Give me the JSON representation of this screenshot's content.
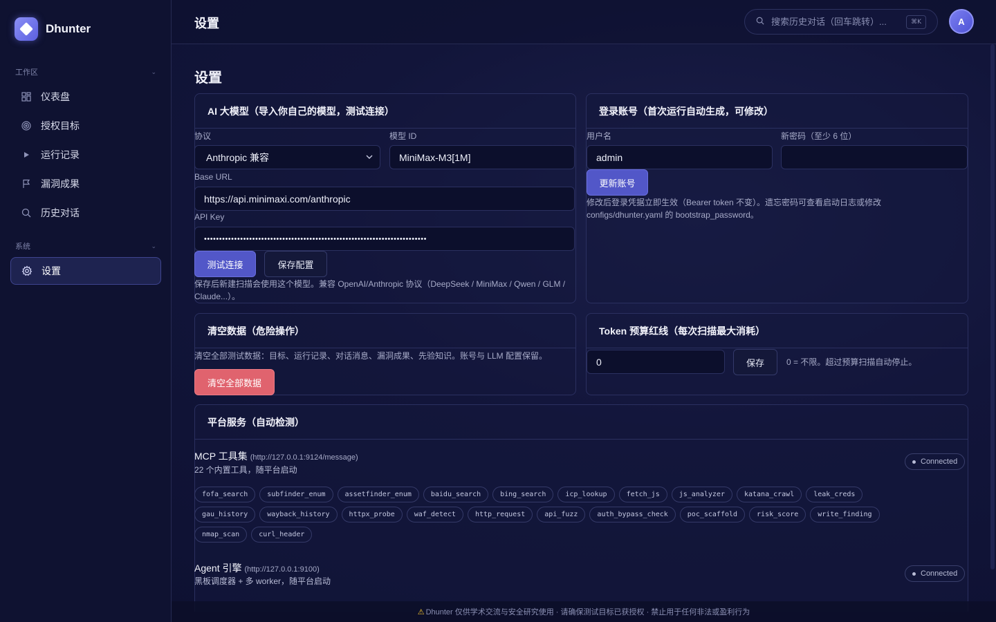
{
  "app": {
    "name": "Dhunter"
  },
  "sidebar": {
    "sections": [
      {
        "label": "工作区",
        "items": [
          {
            "label": "仪表盘",
            "icon": "grid-icon"
          },
          {
            "label": "授权目标",
            "icon": "target-icon"
          },
          {
            "label": "运行记录",
            "icon": "play-icon"
          },
          {
            "label": "漏洞成果",
            "icon": "flag-icon"
          },
          {
            "label": "历史对话",
            "icon": "search-icon"
          }
        ]
      },
      {
        "label": "系统",
        "items": [
          {
            "label": "设置",
            "icon": "gear-icon",
            "active": true
          }
        ]
      }
    ]
  },
  "topbar": {
    "title": "设置",
    "search": {
      "placeholder": "搜索历史对话（回车跳转）...",
      "shortcut": "⌘K"
    },
    "avatar": "A"
  },
  "page": {
    "title": "设置"
  },
  "llm_card": {
    "title": "AI 大模型（导入你自己的模型，测试连接）",
    "protocol_label": "协议",
    "protocol_value": "Anthropic 兼容",
    "model_label": "模型 ID",
    "model_value": "MiniMax-M3[1M]",
    "base_url_label": "Base URL",
    "base_url_value": "https://api.minimaxi.com/anthropic",
    "api_key_label": "API Key",
    "api_key_value": "••••••••••••••••••••••••••••••••••••••••••••••••••••••••••••••••••••••••••",
    "test_button": "测试连接",
    "save_button": "保存配置",
    "note": "保存后新建扫描会使用这个模型。兼容 OpenAI/Anthropic 协议（DeepSeek / MiniMax / Qwen / GLM / Claude...）。"
  },
  "account_card": {
    "title": "登录账号（首次运行自动生成，可修改）",
    "username_label": "用户名",
    "username_value": "admin",
    "password_label": "新密码（至少 6 位）",
    "password_value": "",
    "update_button": "更新账号",
    "note": "修改后登录凭据立即生效（Bearer token 不变）。遗忘密码可查看启动日志或修改 configs/dhunter.yaml 的 bootstrap_password。"
  },
  "clear_card": {
    "title": "清空数据（危险操作）",
    "note": "清空全部测试数据：目标、运行记录、对话消息、漏洞成果、先验知识。账号与 LLM 配置保留。",
    "button": "清空全部数据"
  },
  "token_card": {
    "title": "Token 预算红线（每次扫描最大消耗）",
    "value": "0",
    "save_button": "保存",
    "note": "0 = 不限。超过预算扫描自动停止。"
  },
  "services_card": {
    "title": "平台服务（自动检测）",
    "mcp": {
      "name": "MCP 工具集",
      "url": "(http://127.0.0.1:9124/message)",
      "desc": "22 个内置工具，随平台启动",
      "status": "Connected",
      "tools": [
        "fofa_search",
        "subfinder_enum",
        "assetfinder_enum",
        "baidu_search",
        "bing_search",
        "icp_lookup",
        "fetch_js",
        "js_analyzer",
        "katana_crawl",
        "leak_creds",
        "gau_history",
        "wayback_history",
        "httpx_probe",
        "waf_detect",
        "http_request",
        "api_fuzz",
        "auth_bypass_check",
        "poc_scaffold",
        "risk_score",
        "write_finding",
        "nmap_scan",
        "curl_header"
      ]
    },
    "agent": {
      "name": "Agent 引擎",
      "url": "(http://127.0.0.1:9100)",
      "desc": "黑板调度器 + 多 worker，随平台启动",
      "status": "Connected"
    }
  },
  "footer": {
    "text": "Dhunter 仅供学术交流与安全研究使用 · 请确保测试目标已获授权 · 禁止用于任何非法或盈利行为"
  }
}
